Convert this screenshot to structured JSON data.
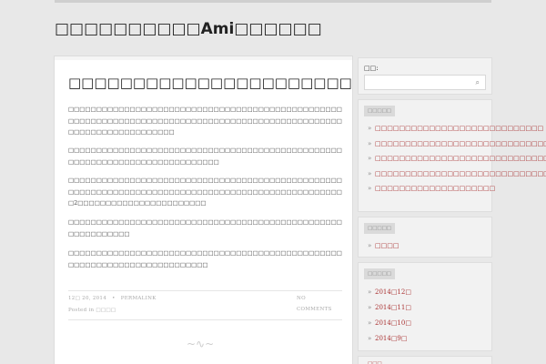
{
  "site": {
    "title": "□□□□□□□□□□Ami□□□□□□"
  },
  "post": {
    "title": "□□□□□□□□□□□□□□□□□□□□□□□□□□□□□□□□",
    "paragraphs": [
      "□□□□□□□□□□□□□□□□□□□□□□□□□□□□□□□□□□□□□□□□□□□□□□□□□□□□□□□□□□□□□□□□□□□□□□□□□□□□□□□□□□□□□□□□□□□□□□□□□□□□□□□□□□□□□□□□□□□□□",
      "□□□□□□□□□□□□□□□□□□□□□□□□□□□□□□□□□□□□□□□□□□□□□□□□□□□□□□□□□□□□□□□□□□□□□□□□□□□□",
      "□□□□□□□□□□□□□□□□□□□□□□□□□□□□□□□□□□□□□□□□□□□□□□□□□□□□□□□□□□□□□□□□□□□□□□□□□□□□□□□□□□□□□□□□□□□□□□□□□□□2□□□□□□□□□□□□□□□□□□□□□□□",
      "□□□□□□□□□□□□□□□□□□□□□□□□□□□□□□□□□□□□□□□□□□□□□□□□□□□□□□□□□□□□",
      "□□□□□□□□□□□□□□□□□□□□□□□□□□□□□□□□□□□□□□□□□□□□□□□□□□□□□□□□□□□□□□□□□□□□□□□□□□"
    ],
    "date": "12□ 20, 2014",
    "bullet": "•",
    "permalink": "PERMALINK",
    "posted_in": "Posted in □□□□",
    "comments_line1": "NO",
    "comments_line2": "COMMENTS"
  },
  "sidebar": {
    "search_label": "□□:",
    "search_placeholder": "",
    "recent_title": "□□□□□",
    "recent_items": [
      "□□□□□□□□□□□□□□□□□□□□□□□□□□□□",
      "□□□□□□□□□□□□□□□□□□□□□□□□□□□□□□",
      "□□□□□□□□□□□□□□□□□□□□□□□□□□□□□",
      "□□□□□□□□□□□□□□□□□□□□□□□□□□□□□□",
      "□□□□□□□□□□□□□□□□□□□□"
    ],
    "categories_title": "□□□□□",
    "categories_items": [
      "□□□□"
    ],
    "archives_title": "□□□□□",
    "archives_items": [
      "2014□12□",
      "2014□11□",
      "2014□10□",
      "2014□9□"
    ],
    "bottom_title": "□□□"
  },
  "colors": {
    "accent": "#aa3333",
    "widget_bg": "#f2f2f2",
    "page_bg": "#e8e8e8"
  }
}
